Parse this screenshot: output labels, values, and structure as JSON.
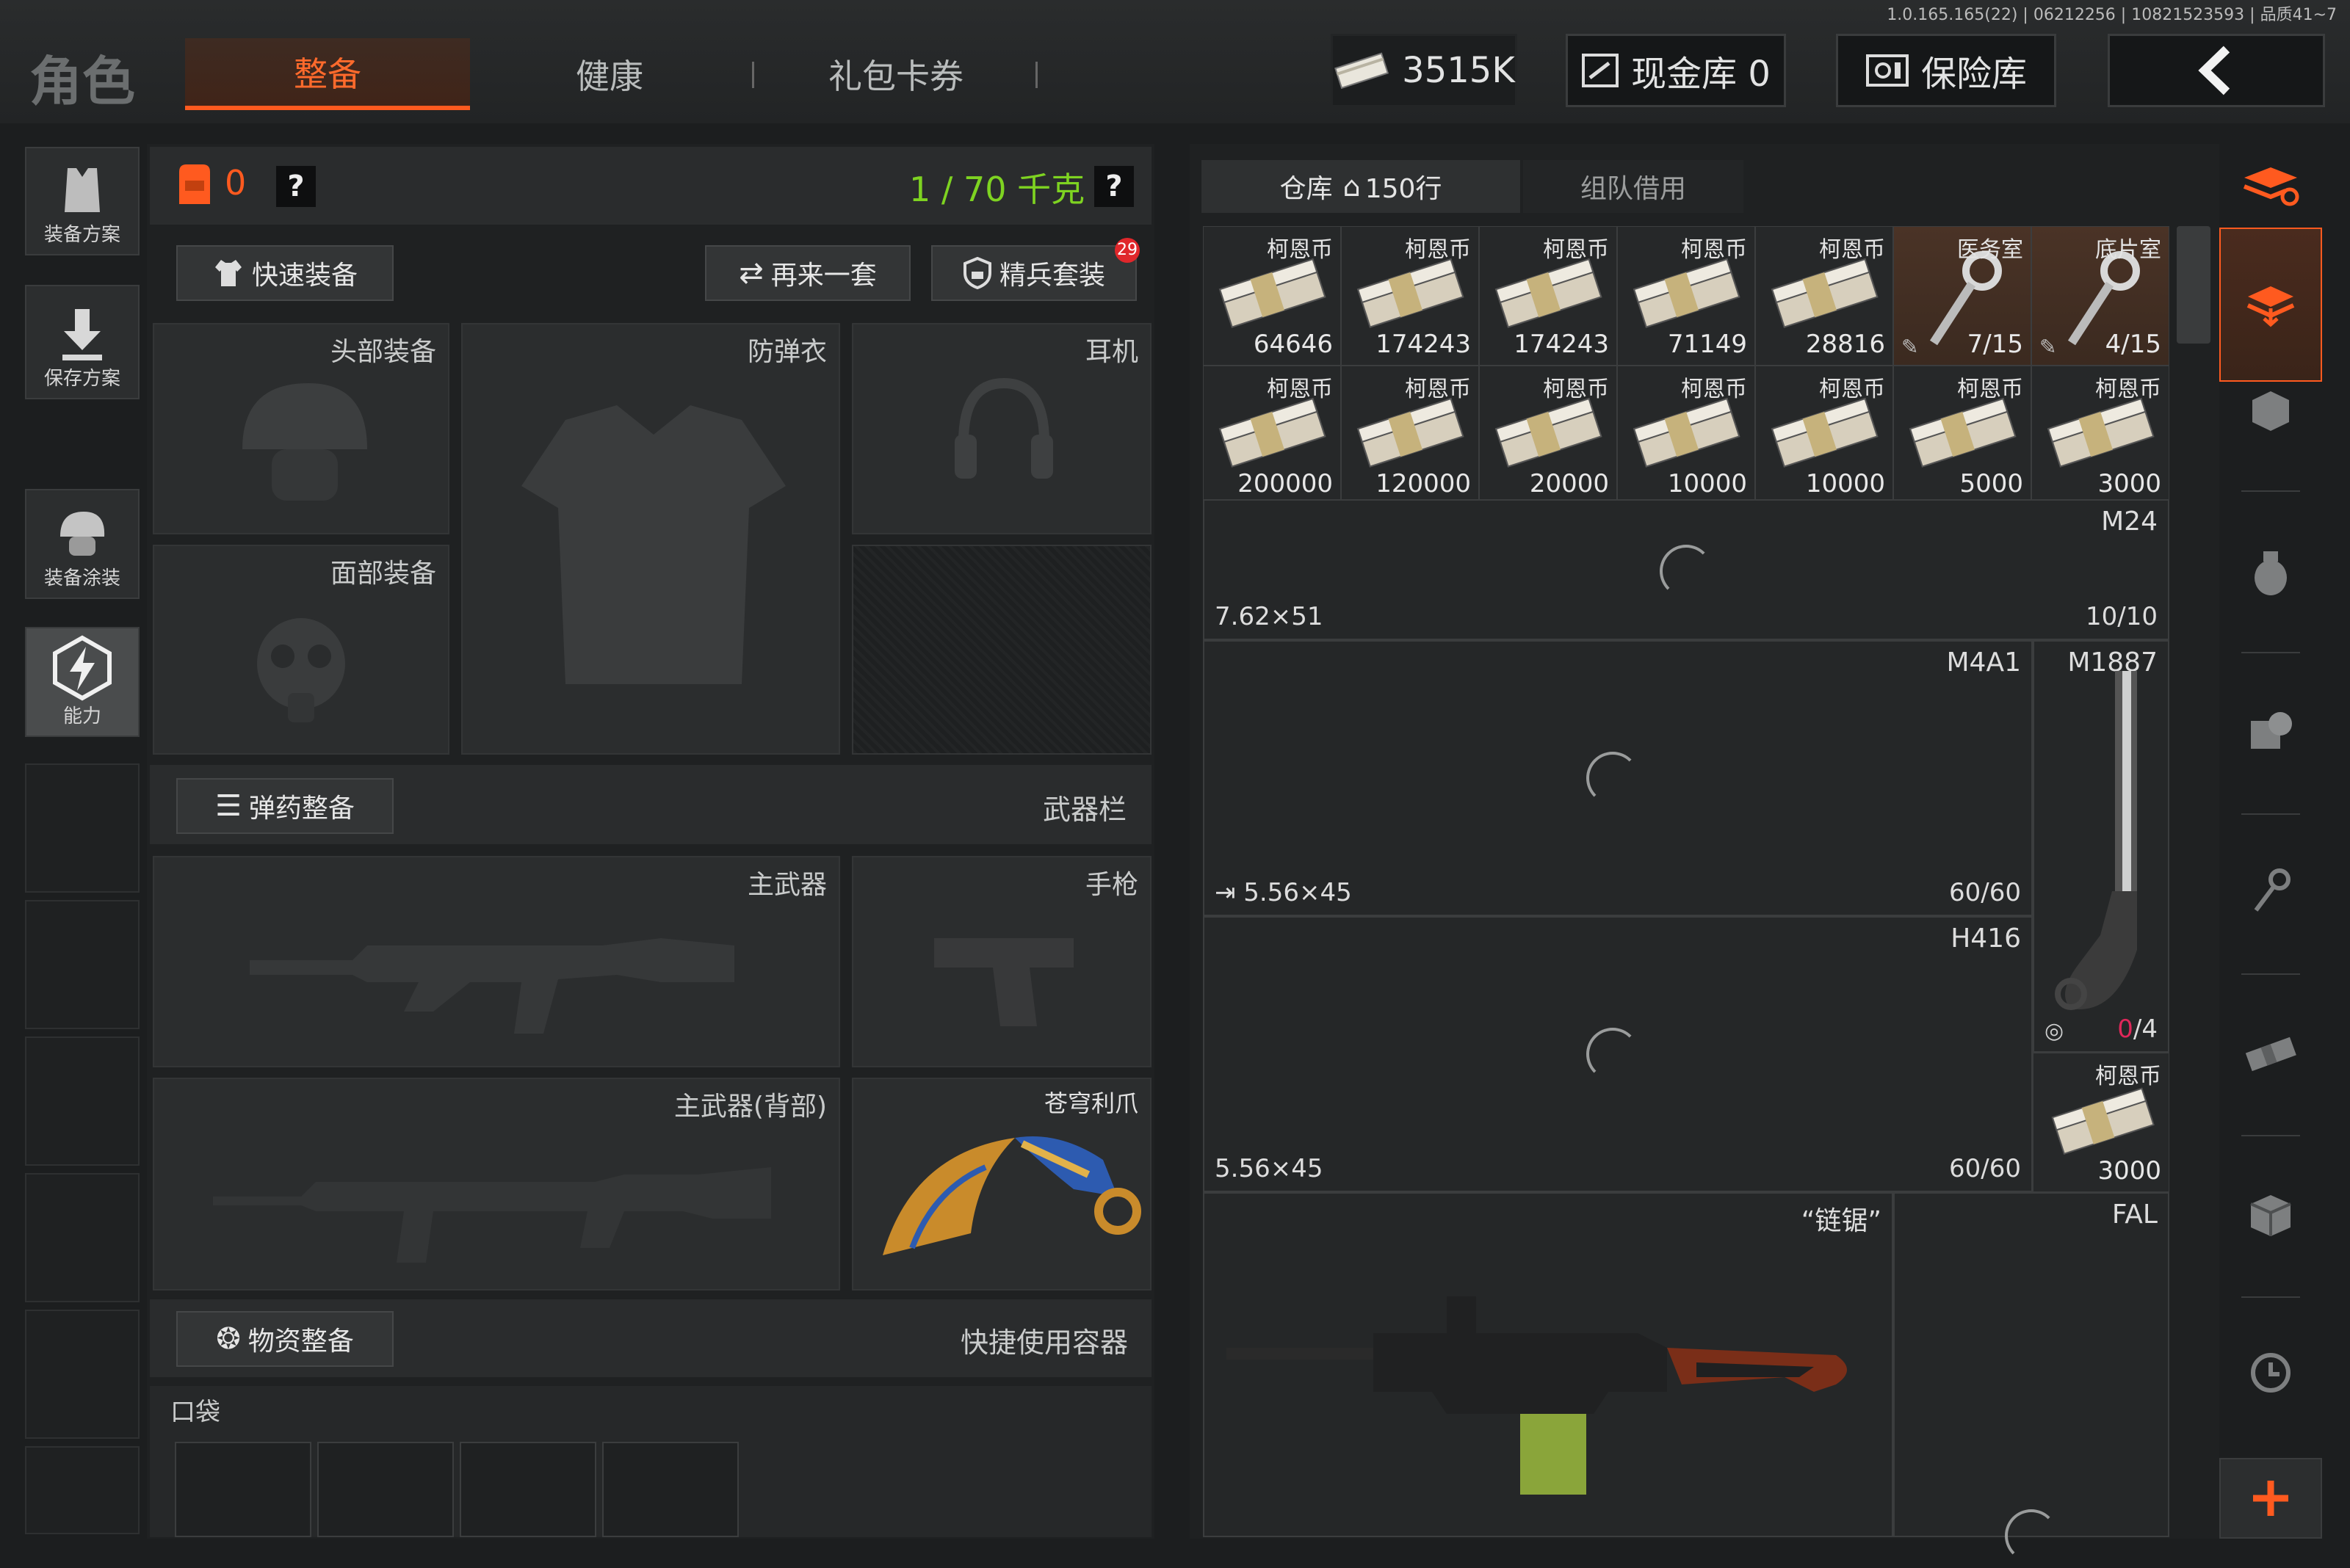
{
  "version": "1.0.165.165(22) | 06212256 | 10821523593 | 品质41~7",
  "header": {
    "title": "角色",
    "tabs": [
      "整备",
      "健康",
      "礼包卡券"
    ],
    "currency": "3515K",
    "cash_vault": "现金库 0",
    "safe": "保险库"
  },
  "left_nav": [
    "装备方案",
    "保存方案",
    "装备涂装",
    "能力"
  ],
  "panel": {
    "count": "0",
    "weight": "1 / 70 千克",
    "help": "?",
    "quick_equip": "快速装备",
    "again": "再来一套",
    "elite": "精兵套装",
    "elite_badge": "29",
    "slots": {
      "head": "头部装备",
      "armor": "防弹衣",
      "ear": "耳机",
      "face": "面部装备"
    },
    "ammo_equip": "弹药整备",
    "weapon_bar": "武器栏",
    "weapons": {
      "primary": "主武器",
      "pistol": "手枪",
      "primary_back": "主武器(背部)",
      "melee": "苍穹利爪"
    },
    "supply_equip": "物资整备",
    "quick_container": "快捷使用容器",
    "pocket": "口袋"
  },
  "storage": {
    "tab_warehouse": "仓库",
    "rows": "150行",
    "tab_team": "组队借用",
    "row1": [
      {
        "name": "柯恩币",
        "qty": "64646"
      },
      {
        "name": "柯恩币",
        "qty": "174243"
      },
      {
        "name": "柯恩币",
        "qty": "174243"
      },
      {
        "name": "柯恩币",
        "qty": "71149"
      },
      {
        "name": "柯恩币",
        "qty": "28816"
      },
      {
        "name": "医务室",
        "qty": "7/15"
      },
      {
        "name": "底片室",
        "qty": "4/15"
      }
    ],
    "row2": [
      {
        "name": "柯恩币",
        "qty": "200000"
      },
      {
        "name": "柯恩币",
        "qty": "120000"
      },
      {
        "name": "柯恩币",
        "qty": "20000"
      },
      {
        "name": "柯恩币",
        "qty": "10000"
      },
      {
        "name": "柯恩币",
        "qty": "10000"
      },
      {
        "name": "柯恩币",
        "qty": "5000"
      },
      {
        "name": "柯恩币",
        "qty": "3000"
      }
    ],
    "m24": {
      "name": "M24",
      "cal": "7.62×51",
      "ammo": "10/10"
    },
    "m4a1": {
      "name": "M4A1",
      "cal": "5.56×45",
      "ammo": "60/60"
    },
    "m1887": {
      "name": "M1887",
      "ammo_a": "0",
      "ammo_b": "/4"
    },
    "h416": {
      "name": "H416",
      "cal": "5.56×45",
      "ammo": "60/60"
    },
    "coin": {
      "name": "柯恩币",
      "qty": "3000"
    },
    "saw": {
      "name": "“链锯”"
    },
    "fal": {
      "name": "FAL"
    }
  },
  "colors": {
    "accent": "#ff5a1f",
    "weight_green": "#7ed321"
  }
}
